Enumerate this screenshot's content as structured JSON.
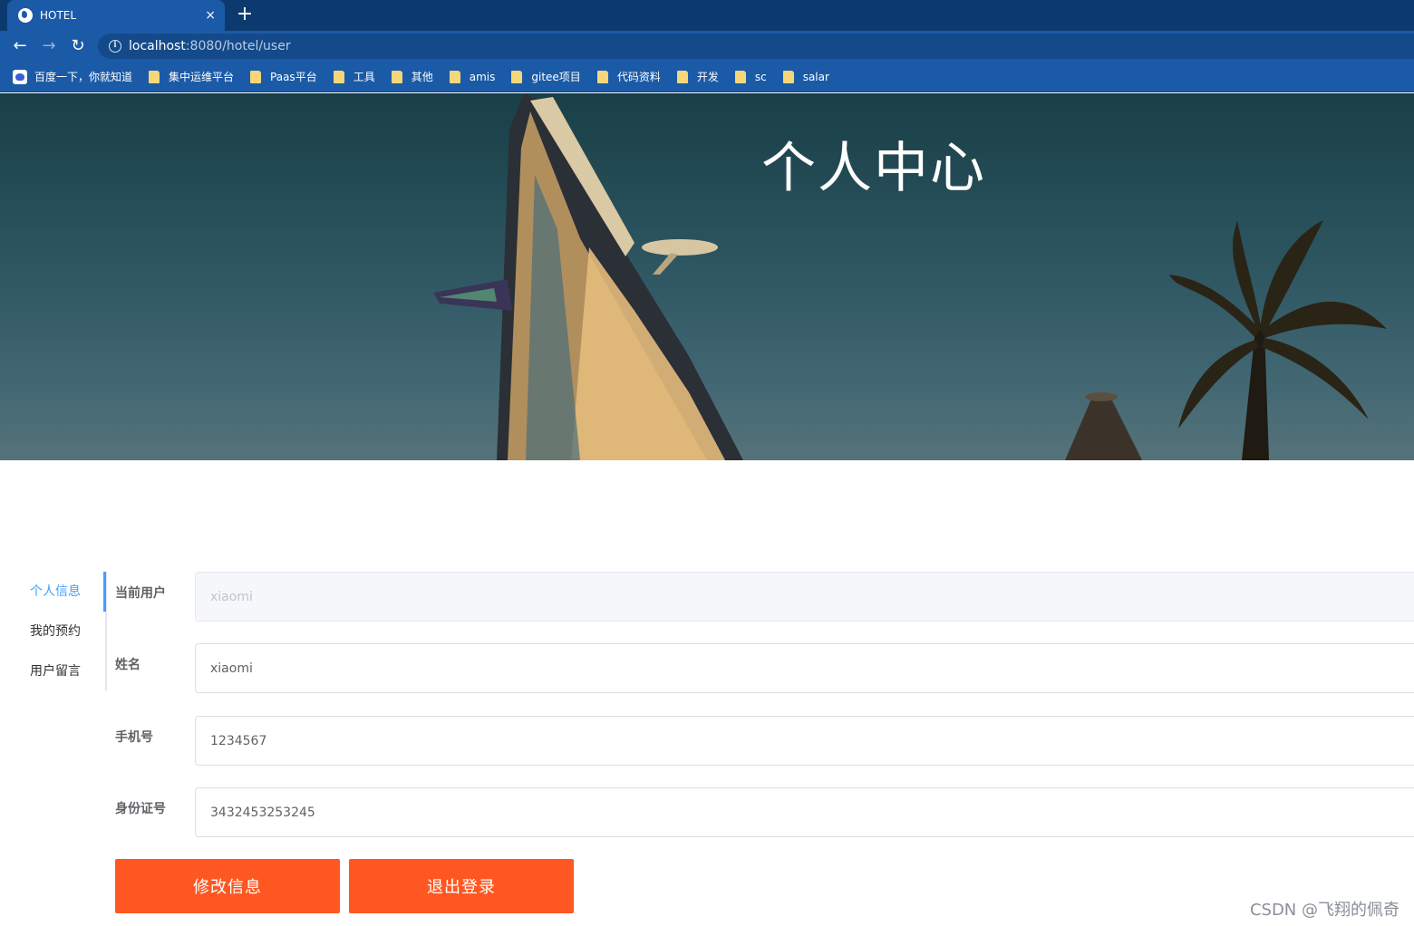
{
  "browser": {
    "tab_title": "HOTEL",
    "tab_close": "×",
    "new_tab": "+",
    "back": "←",
    "forward": "→",
    "reload": "↻",
    "url_host": "localhost",
    "url_path": ":8080/hotel/user",
    "bookmarks": [
      {
        "label": "百度一下，你就知道",
        "icon": "baidu-icon"
      },
      {
        "label": "集中运维平台",
        "icon": "folder-icon"
      },
      {
        "label": "Paas平台",
        "icon": "folder-icon"
      },
      {
        "label": "工具",
        "icon": "folder-icon"
      },
      {
        "label": "其他",
        "icon": "folder-icon"
      },
      {
        "label": "amis",
        "icon": "folder-icon"
      },
      {
        "label": "gitee项目",
        "icon": "folder-icon"
      },
      {
        "label": "代码资料",
        "icon": "folder-icon"
      },
      {
        "label": "开发",
        "icon": "folder-icon"
      },
      {
        "label": "sc",
        "icon": "folder-icon"
      },
      {
        "label": "salar",
        "icon": "folder-icon"
      }
    ]
  },
  "hero": {
    "title": "个人中心"
  },
  "menu": {
    "items": [
      {
        "label": "个人信息",
        "active": true
      },
      {
        "label": "我的预约",
        "active": false
      },
      {
        "label": "用户留言",
        "active": false
      }
    ],
    "active_color": "#409eff"
  },
  "form": {
    "current_user_label": "当前用户",
    "current_user_value": "xiaomi",
    "name_label": "姓名",
    "name_value": "xiaomi",
    "phone_label": "手机号",
    "phone_value": "1234567",
    "idcard_label": "身份证号",
    "idcard_value": "3432453253245"
  },
  "actions": {
    "edit_label": "修改信息",
    "logout_label": "退出登录",
    "button_color": "#ff5722"
  },
  "watermark": "CSDN @飞翔的佩奇"
}
